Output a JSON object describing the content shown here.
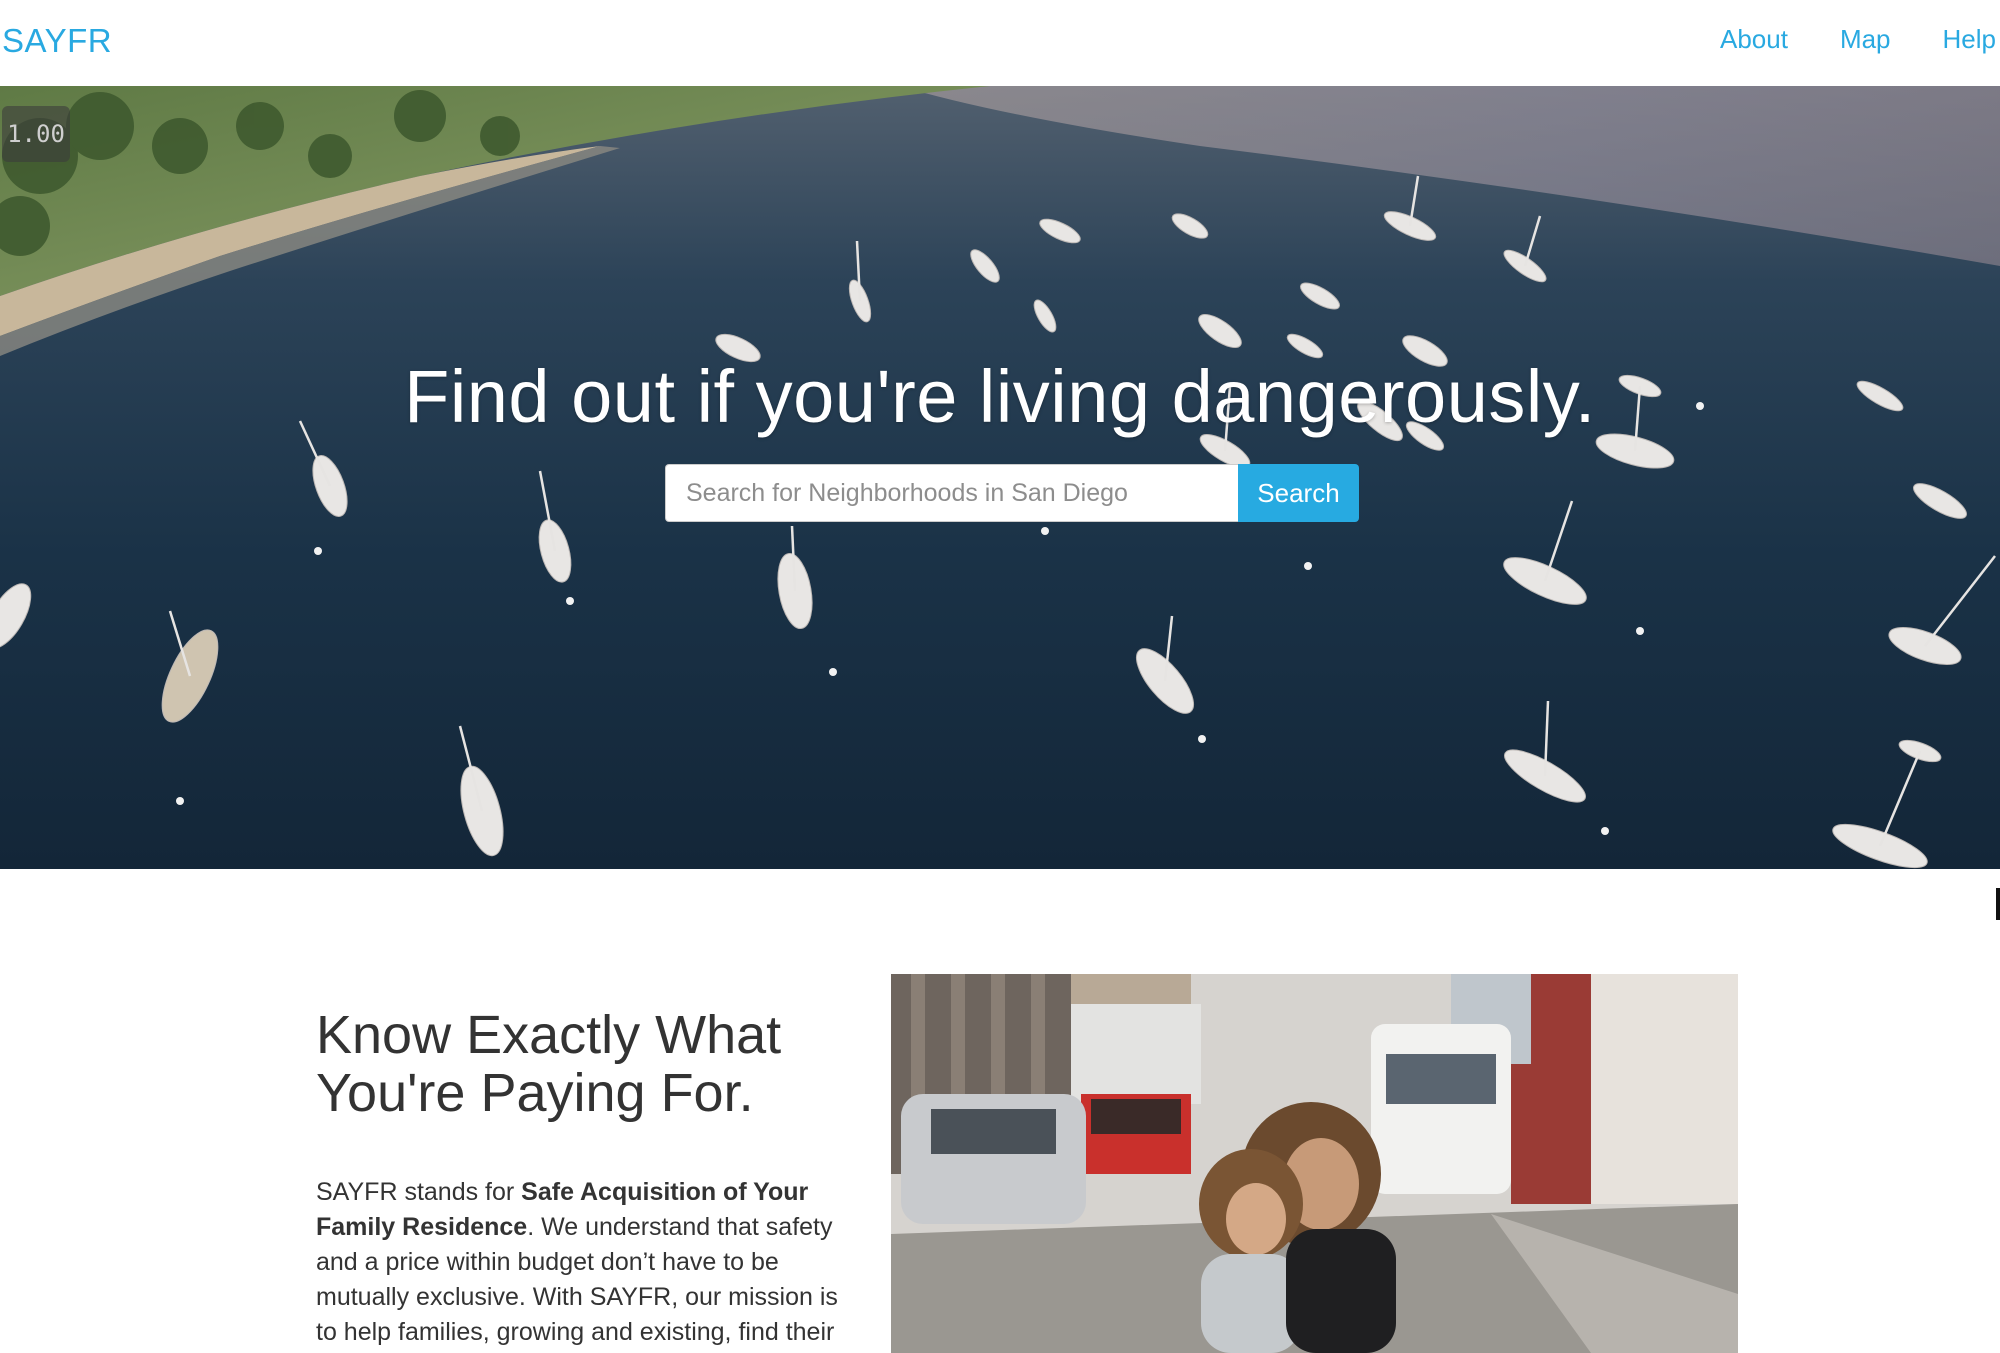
{
  "navbar": {
    "brand": "SAYFR",
    "links": [
      "About",
      "Map",
      "Help"
    ]
  },
  "hero": {
    "speed_badge": "1.00",
    "title": "Find out if you're living dangerously.",
    "search": {
      "placeholder": "Search for Neighborhoods in San Diego",
      "value": "",
      "button_label": "Search"
    }
  },
  "feature": {
    "title_line1": "Know Exactly What",
    "title_line2": "You're Paying For.",
    "text_intro": "SAYFR stands for ",
    "text_bold": "Safe Acquisition of Your Family Residence",
    "text_rest": ". We understand that safety and a price within budget don’t have to be mutually exclusive. With SAYFR, our mission is to help families, growing and existing, find their"
  },
  "colors": {
    "accent": "#29a9e1",
    "button": "#27aae1",
    "water": "#1a3247"
  }
}
